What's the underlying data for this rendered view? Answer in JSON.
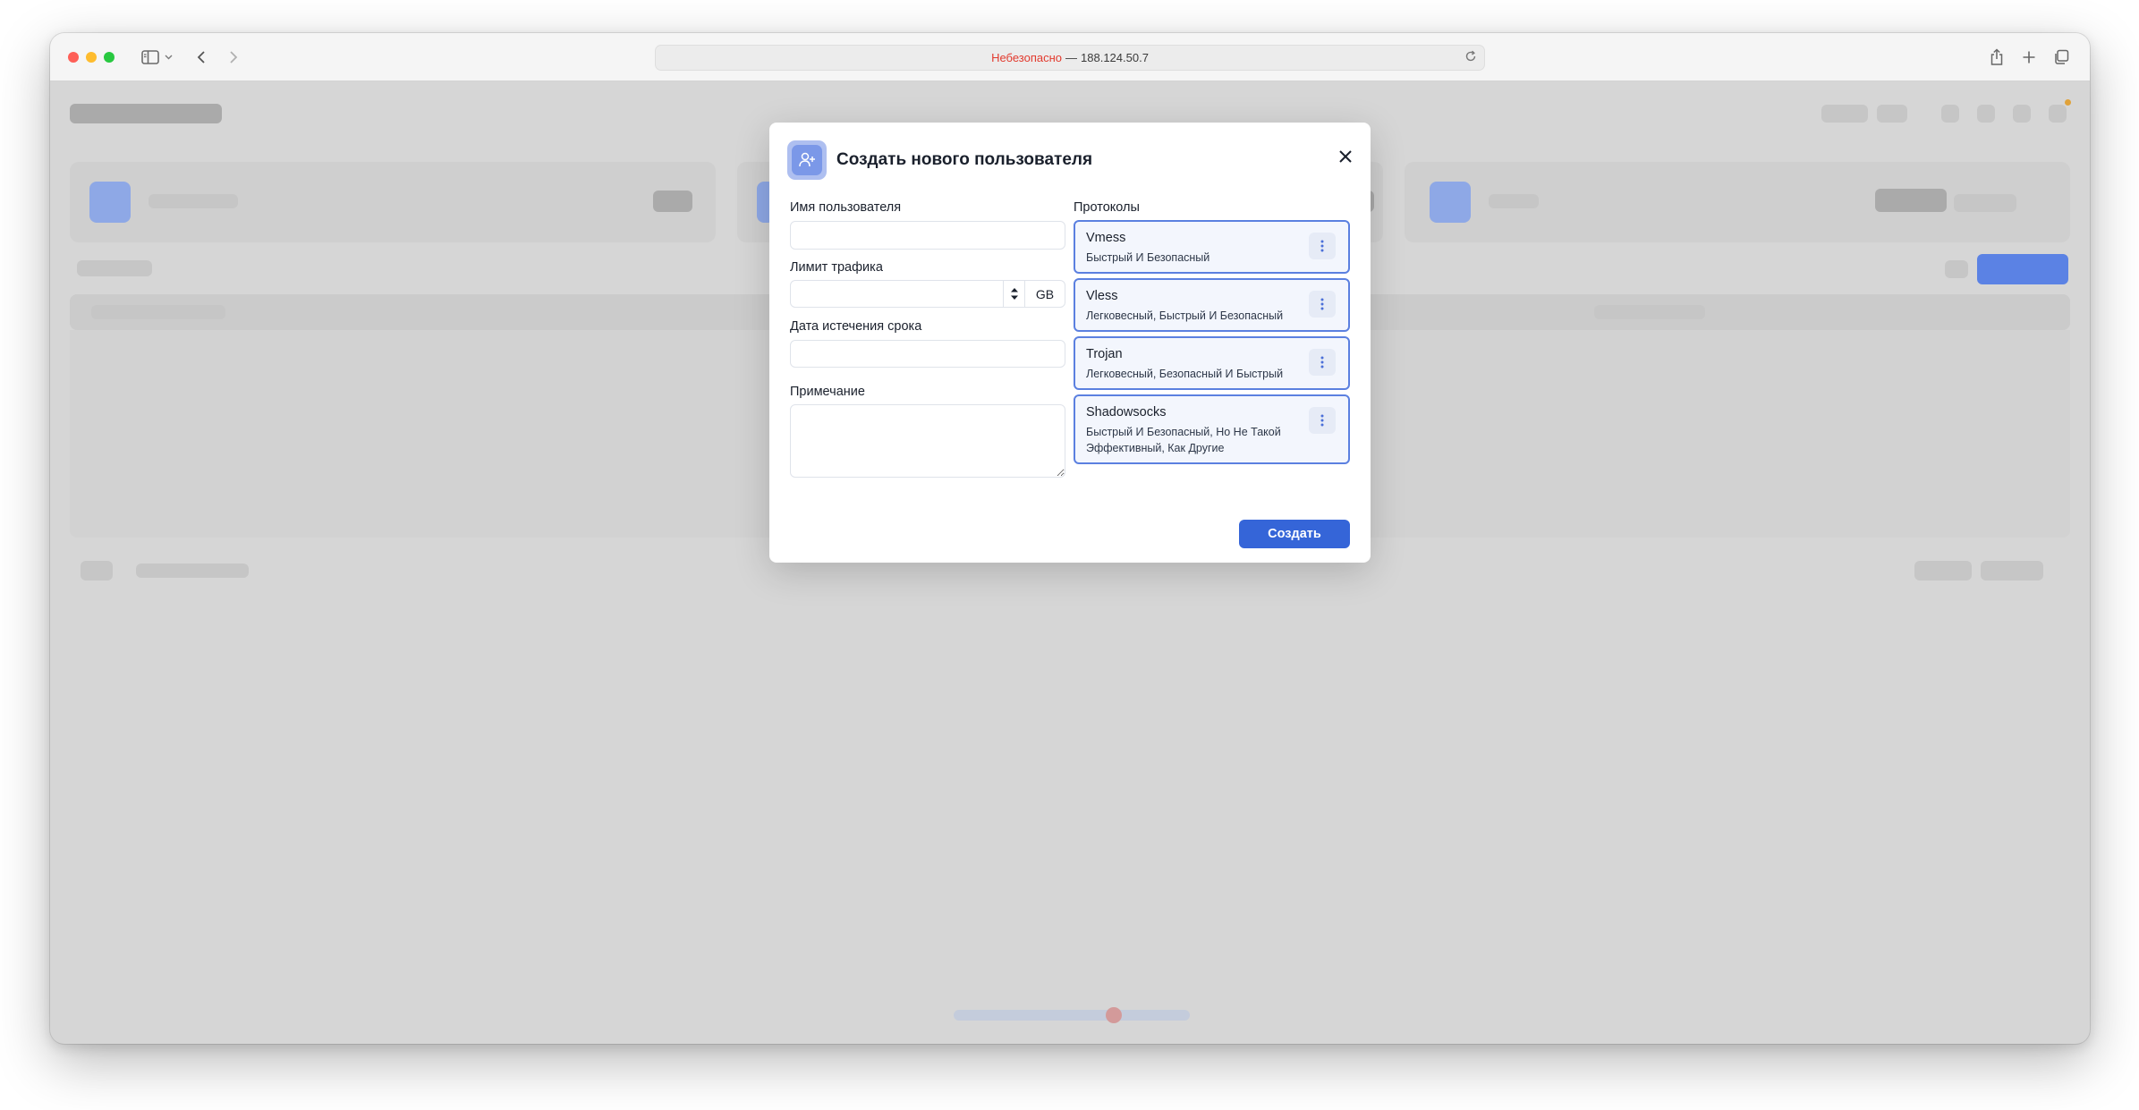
{
  "browser": {
    "security_label": "Небезопасно",
    "separator": "—",
    "address": "188.124.50.7"
  },
  "modal": {
    "title": "Создать нового пользователя",
    "username_label": "Имя пользователя",
    "username_value": "",
    "traffic_label": "Лимит трафика",
    "traffic_value": "",
    "traffic_unit": "GB",
    "expiry_label": "Дата истечения срока",
    "expiry_value": "",
    "note_label": "Примечание",
    "note_value": "",
    "protocols_label": "Протоколы",
    "protocols": [
      {
        "name": "Vmess",
        "description": "Быстрый И Безопасный"
      },
      {
        "name": "Vless",
        "description": "Легковесный, Быстрый И Безопасный"
      },
      {
        "name": "Trojan",
        "description": "Легковесный, Безопасный И Быстрый"
      },
      {
        "name": "Shadowsocks",
        "description": "Быстрый И Безопасный, Но Не Такой Эффективный, Как Другие"
      }
    ],
    "submit_label": "Создать"
  },
  "colors": {
    "primary": "#3565d8",
    "protocol_border": "#5b80e0",
    "protocol_bg": "#f3f6fd",
    "overlay_page": "#d6d6d6",
    "insecure": "#e23a2e"
  }
}
